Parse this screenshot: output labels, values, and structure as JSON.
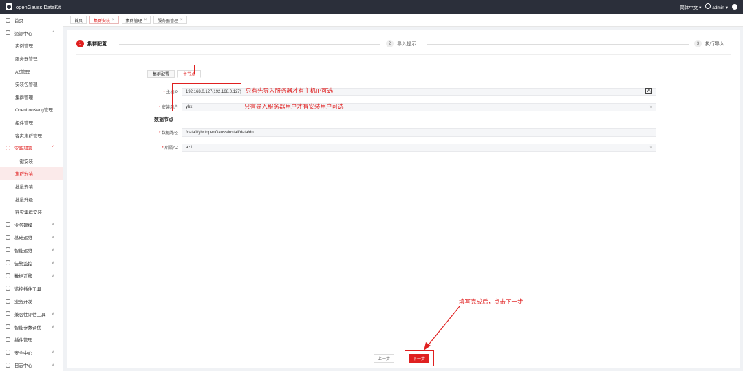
{
  "topbar": {
    "brand": "openGauss DataKit",
    "language": "简体中文",
    "user": "admin",
    "dropdown": "▾"
  },
  "tabs": [
    {
      "label": "首页",
      "close": ""
    },
    {
      "label": "集群安装",
      "close": "×"
    },
    {
      "label": "集群管理",
      "close": "×"
    },
    {
      "label": "服务器管理",
      "close": "×"
    }
  ],
  "sidebar": {
    "items": [
      {
        "label": "首页",
        "chev": ""
      },
      {
        "label": "资源中心",
        "chev": "^"
      },
      {
        "label": "实例管理"
      },
      {
        "label": "服务器管理"
      },
      {
        "label": "AZ管理"
      },
      {
        "label": "安装包管理"
      },
      {
        "label": "集群管理"
      },
      {
        "label": "OpenLooKeng管理"
      },
      {
        "label": "组件管理"
      },
      {
        "label": "容灾集群管理"
      },
      {
        "label": "安装部署",
        "chev": "^"
      },
      {
        "label": "一键安装"
      },
      {
        "label": "集群安装"
      },
      {
        "label": "批量安装"
      },
      {
        "label": "批量升级"
      },
      {
        "label": "容灾集群安装"
      },
      {
        "label": "业务建模",
        "chev": "∨"
      },
      {
        "label": "基础运维",
        "chev": "∨"
      },
      {
        "label": "智能运维",
        "chev": "∨"
      },
      {
        "label": "告警监控",
        "chev": "∨"
      },
      {
        "label": "数据迁移",
        "chev": "∨"
      },
      {
        "label": "监控插件工具",
        "chev": ""
      },
      {
        "label": "业务开发",
        "chev": ""
      },
      {
        "label": "兼容性评估工具",
        "chev": "∨"
      },
      {
        "label": "智能参数调优",
        "chev": "∨"
      },
      {
        "label": "插件管理",
        "chev": ""
      },
      {
        "label": "安全中心",
        "chev": "∨"
      },
      {
        "label": "日志中心",
        "chev": "∨"
      }
    ]
  },
  "steps": [
    {
      "num": "1",
      "label": "集群配置"
    },
    {
      "num": "2",
      "label": "导入提示"
    },
    {
      "num": "3",
      "label": "执行导入"
    }
  ],
  "form": {
    "tab_cluster": "集群配置",
    "tab_master": "主节点",
    "tab_add": "+",
    "host_label": "主机IP",
    "host_value": "192.168.0.127(192.168.0.127)",
    "install_user_label": "安装用户",
    "install_user_value": "ybx",
    "section": "数据节点",
    "data_path_label": "数据路径",
    "data_path_value": "/data1/ybx/openGauss/install/data/dn",
    "az_label": "所属AZ",
    "az_value": "az1",
    "host_icon_text": "W",
    "required_mark": "*",
    "dd_icon": "∨"
  },
  "annotations": {
    "host_note": "只有先导入服务器才有主机IP可选",
    "user_note": "只有导入服务器用户才有安装用户可选",
    "next_note": "填写完成后，点击下一步"
  },
  "buttons": {
    "prev": "上一步",
    "next": "下一步"
  },
  "colors": {
    "accent": "#e02020",
    "topbar": "#2b2f3a"
  }
}
